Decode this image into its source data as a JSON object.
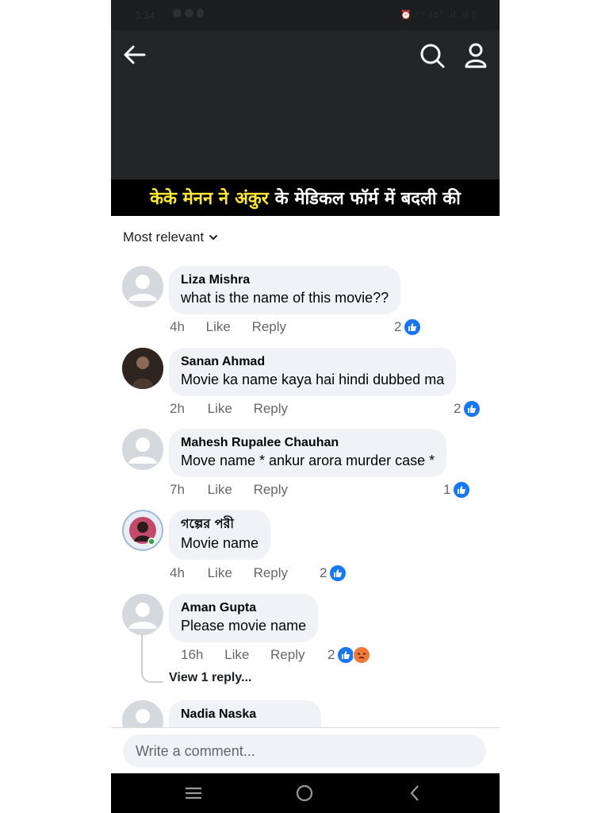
{
  "status_bar": {
    "time": "3:34",
    "right": "⏰ ⁴ᴳ 46° .ıl .ıl ▯"
  },
  "header": {
    "caption_prefix": "केके मेनन ने",
    "caption_highlight": "अंकुर",
    "caption_suffix": "के मेडिकल फॉर्म में बदली की"
  },
  "sort": {
    "label": "Most relevant"
  },
  "comments": [
    {
      "name": "Liza Mishra",
      "text": "what is the name of this movie??",
      "time": "4h",
      "like": "Like",
      "reply": "Reply",
      "reactions": "2"
    },
    {
      "name": "Sanan Ahmad",
      "text": "Movie ka name kaya hai hindi dubbed ma",
      "time": "2h",
      "like": "Like",
      "reply": "Reply",
      "reactions": "2"
    },
    {
      "name": "Mahesh Rupalee Chauhan",
      "text": "Move name * ankur arora murder case *",
      "time": "7h",
      "like": "Like",
      "reply": "Reply",
      "reactions": "1"
    },
    {
      "name": "গল্পের পরী",
      "text": "Movie name",
      "time": "4h",
      "like": "Like",
      "reply": "Reply",
      "reactions": "2"
    },
    {
      "name": "Aman Gupta",
      "text": "Please movie name",
      "time": "16h",
      "like": "Like",
      "reply": "Reply",
      "reactions": "2"
    },
    {
      "name": "Nadia Naska"
    }
  ],
  "view_replies": "View 1 reply...",
  "composer": {
    "placeholder": "Write a comment..."
  },
  "colors": {
    "like_blue": "#1877f2",
    "bubble": "#f0f2f5",
    "caption_highlight": "#ffe838"
  }
}
